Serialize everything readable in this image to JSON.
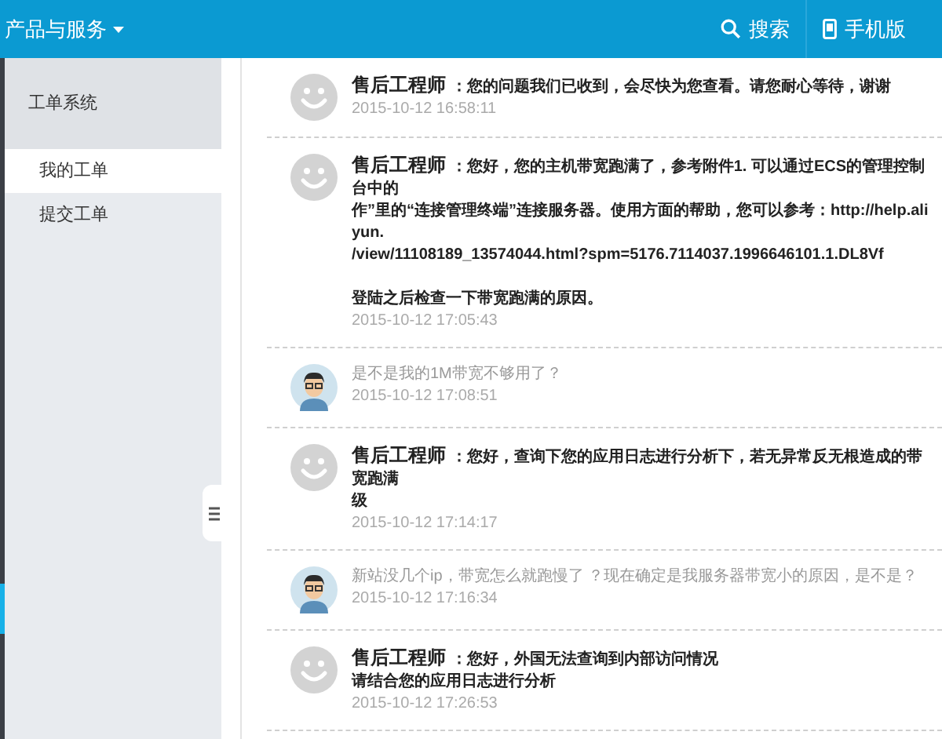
{
  "topbar": {
    "menu": "产品与服务",
    "actions": [
      {
        "kind": "search",
        "label": "搜索"
      },
      {
        "kind": "mobile",
        "label": "手机版"
      }
    ]
  },
  "sidebar": {
    "section": "工单系统",
    "items": [
      {
        "label": "我的工单",
        "selected": true
      },
      {
        "label": "提交工单",
        "selected": false
      }
    ]
  },
  "messages": [
    {
      "kind": "engineer",
      "author": "售后工程师",
      "paragraphs": [
        [
          "：您的问题我们已收到，会尽快为您查看。请您耐心等待，谢谢"
        ]
      ],
      "time": "2015-10-12 16:58:11"
    },
    {
      "kind": "engineer",
      "author": "售后工程师",
      "paragraphs": [
        [
          "：您好，您的主机带宽跑满了，参考附件1. 可以通过ECS的管理控制台中的",
          "作”里的“连接管理终端”连接服务器。使用方面的帮助，您可以参考：http://help.aliyun.",
          "/view/11108189_13574044.html?spm=5176.7114037.1996646101.1.DL8Vf"
        ],
        [
          "登陆之后检查一下带宽跑满的原因。"
        ]
      ],
      "time": "2015-10-12 17:05:43"
    },
    {
      "kind": "user",
      "paragraphs": [
        [
          "是不是我的1M带宽不够用了？"
        ]
      ],
      "time": "2015-10-12 17:08:51"
    },
    {
      "kind": "engineer",
      "author": "售后工程师",
      "paragraphs": [
        [
          "：您好，查询下您的应用日志进行分析下，若无异常反无根造成的带宽跑满",
          "级"
        ]
      ],
      "time": "2015-10-12 17:14:17"
    },
    {
      "kind": "user",
      "paragraphs": [
        [
          "新站没几个ip，带宽怎么就跑慢了 ？现在确定是我服务器带宽小的原因，是不是？"
        ]
      ],
      "time": "2015-10-12 17:16:34"
    },
    {
      "kind": "engineer",
      "author": "售后工程师",
      "paragraphs": [
        [
          "：您好，外国无法查询到内部访问情况",
          "请结合您的应用日志进行分析"
        ]
      ],
      "time": "2015-10-12 17:26:53"
    }
  ]
}
